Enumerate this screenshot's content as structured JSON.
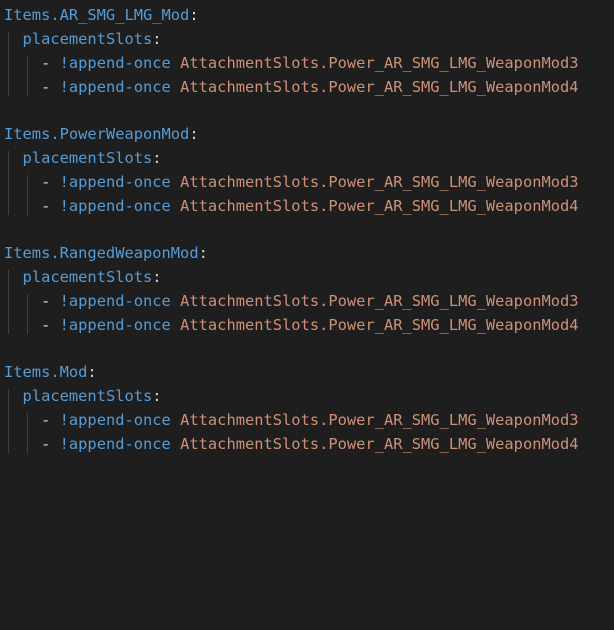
{
  "editor": {
    "language": "yaml",
    "colors": {
      "background": "#1e1e1e",
      "key": "#569cd6",
      "tag": "#569cd6",
      "value": "#ce9178",
      "punctuation": "#d4d4d4",
      "indent_guide": "#404040"
    },
    "blocks": [
      {
        "key": "Items.AR_SMG_LMG_Mod",
        "colon": ":",
        "property": "placementSlots",
        "prop_colon": ":",
        "items": [
          {
            "dash": "- ",
            "tag": "!append-once",
            "value": "AttachmentSlots.Power_AR_SMG_LMG_WeaponMod3"
          },
          {
            "dash": "- ",
            "tag": "!append-once",
            "value": "AttachmentSlots.Power_AR_SMG_LMG_WeaponMod4"
          }
        ]
      },
      {
        "key": "Items.PowerWeaponMod",
        "colon": ":",
        "property": "placementSlots",
        "prop_colon": ":",
        "items": [
          {
            "dash": "- ",
            "tag": "!append-once",
            "value": "AttachmentSlots.Power_AR_SMG_LMG_WeaponMod3"
          },
          {
            "dash": "- ",
            "tag": "!append-once",
            "value": "AttachmentSlots.Power_AR_SMG_LMG_WeaponMod4"
          }
        ]
      },
      {
        "key": "Items.RangedWeaponMod",
        "colon": ":",
        "property": "placementSlots",
        "prop_colon": ":",
        "items": [
          {
            "dash": "- ",
            "tag": "!append-once",
            "value": "AttachmentSlots.Power_AR_SMG_LMG_WeaponMod3"
          },
          {
            "dash": "- ",
            "tag": "!append-once",
            "value": "AttachmentSlots.Power_AR_SMG_LMG_WeaponMod4"
          }
        ]
      },
      {
        "key": "Items.Mod",
        "colon": ":",
        "property": "placementSlots",
        "prop_colon": ":",
        "items": [
          {
            "dash": "- ",
            "tag": "!append-once",
            "value": "AttachmentSlots.Power_AR_SMG_LMG_WeaponMod3"
          },
          {
            "dash": "- ",
            "tag": "!append-once",
            "value": "AttachmentSlots.Power_AR_SMG_LMG_WeaponMod4"
          }
        ]
      }
    ]
  }
}
